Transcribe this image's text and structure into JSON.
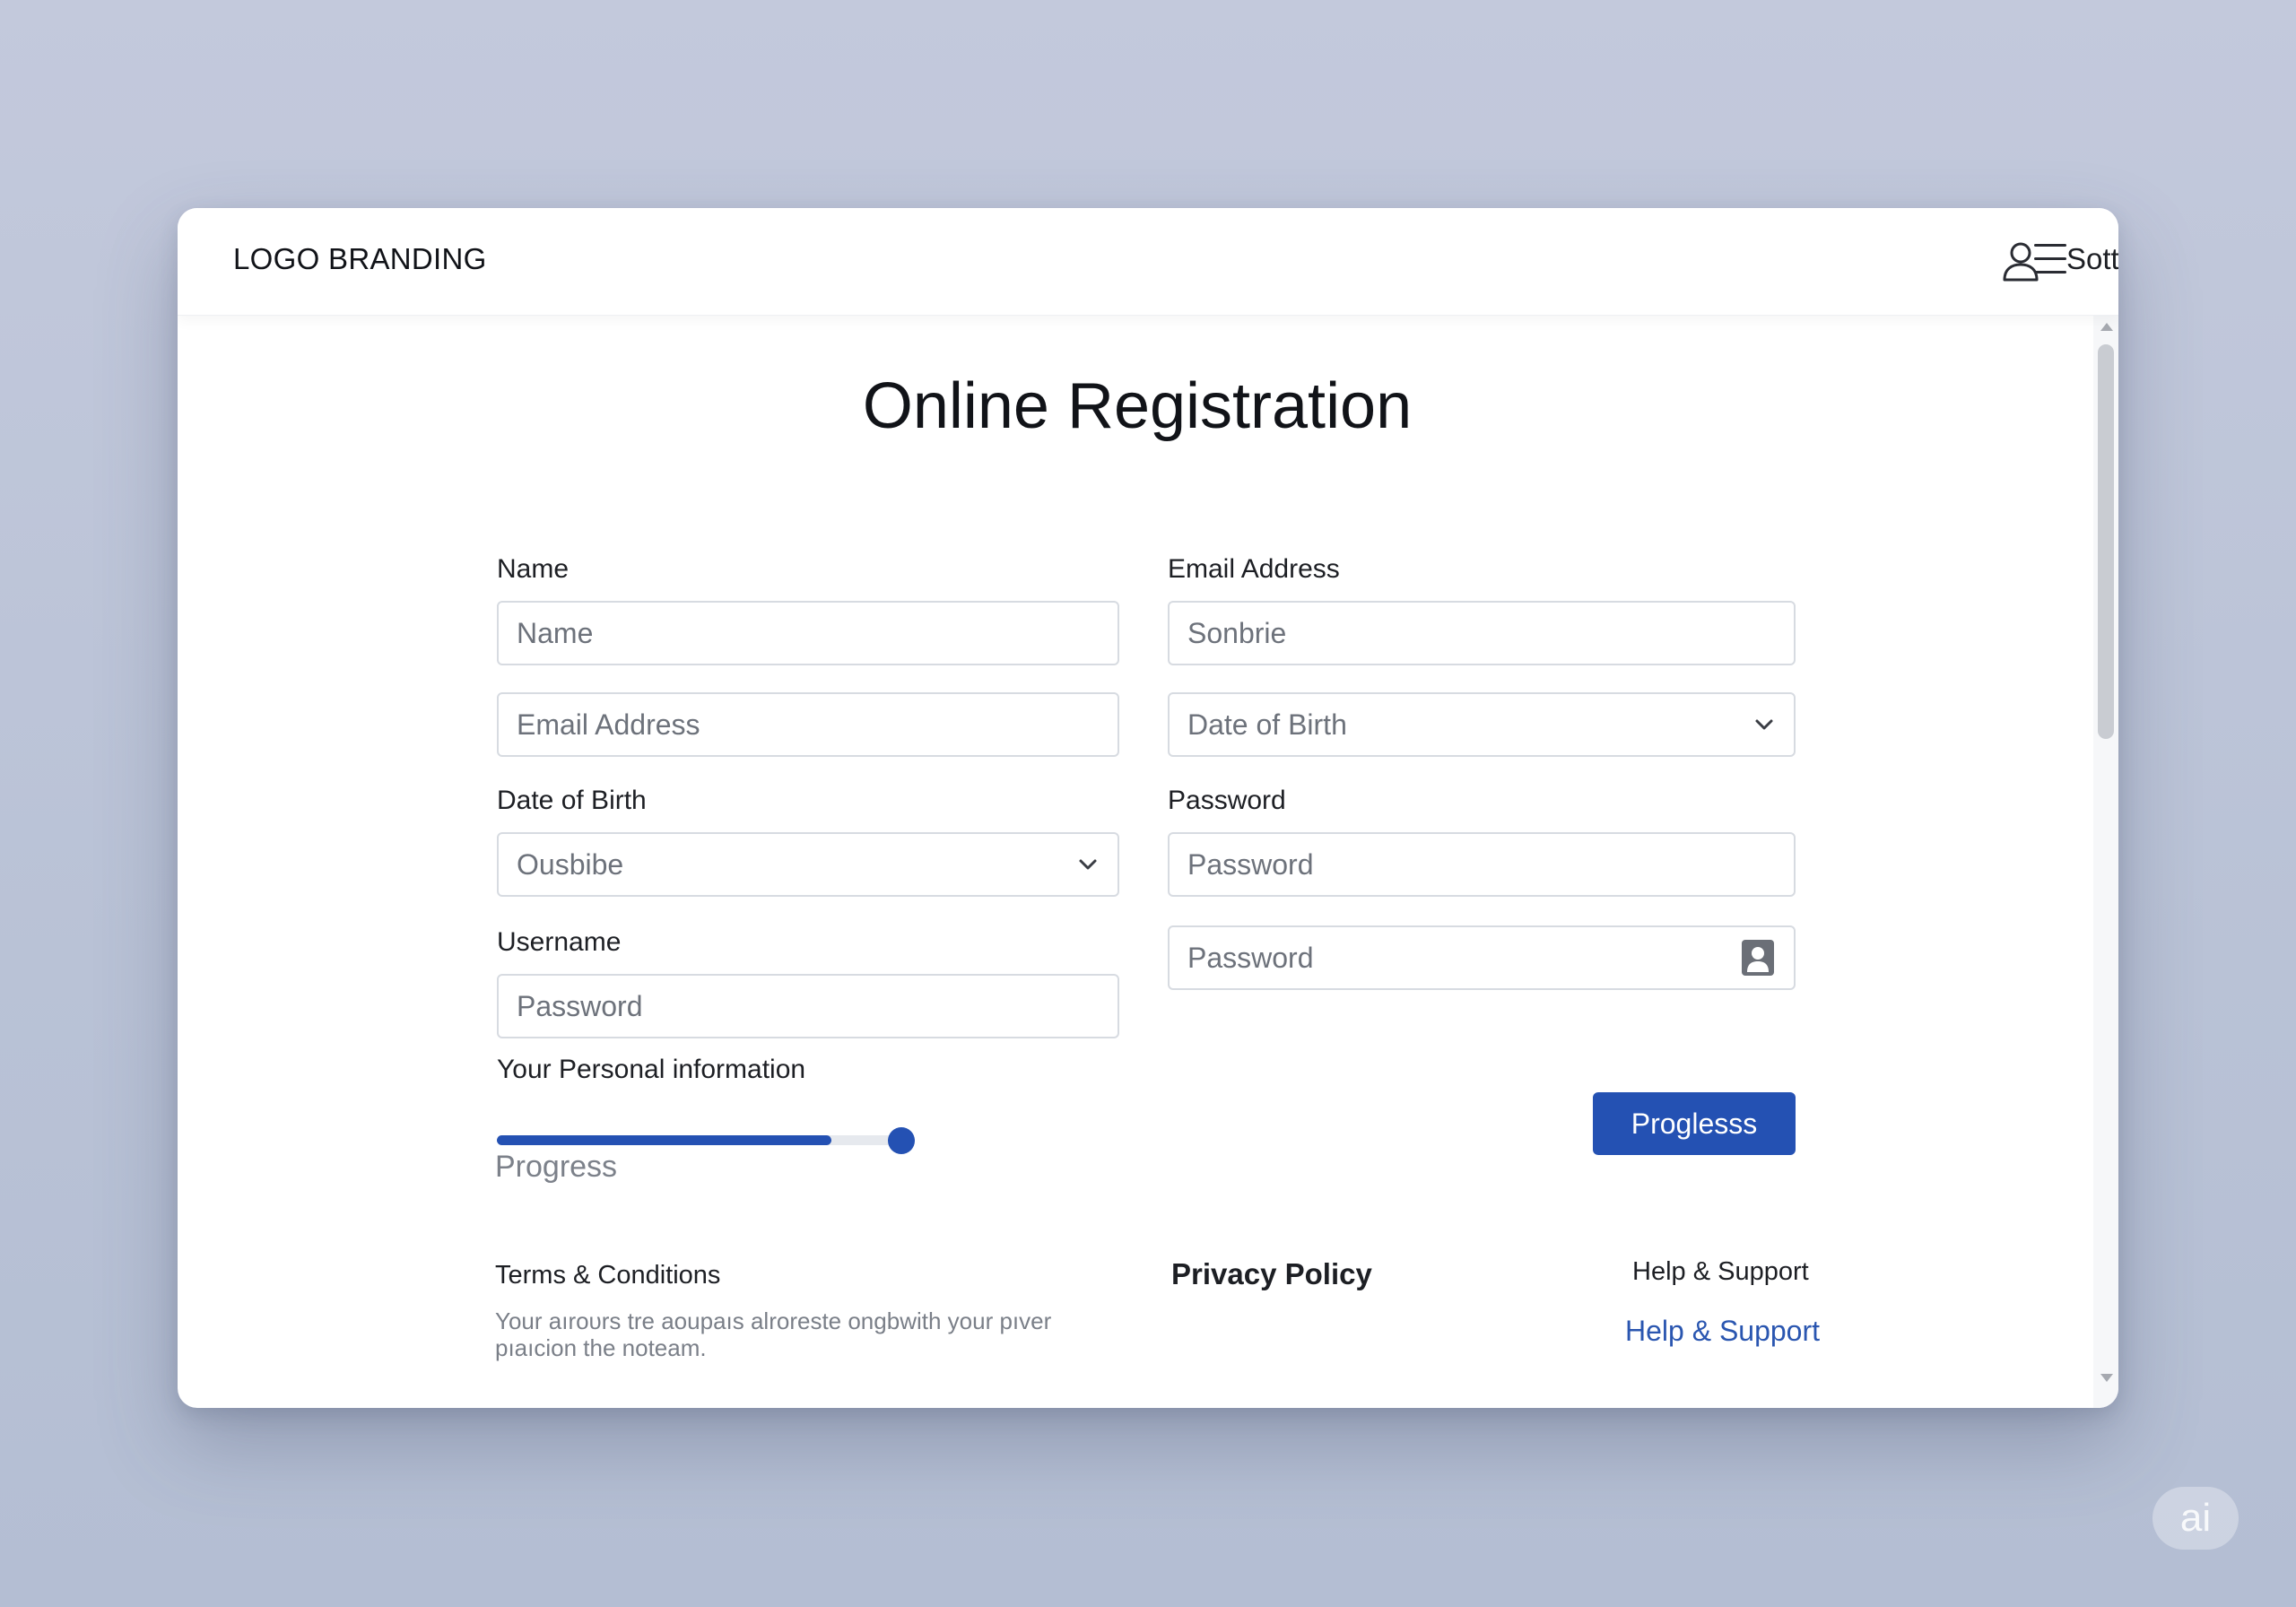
{
  "header": {
    "logo": "LOGO BRANDING",
    "user_name": "Sottom",
    "user_icon": "user-icon",
    "menu_icon": "hamburger-menu-icon"
  },
  "page": {
    "title": "Online Registration"
  },
  "form": {
    "name_label": "Name",
    "name_placeholder": "Name",
    "email_label": "Email Address",
    "email_value": "Sonbrie",
    "email_placeholder_left": "Email Address",
    "dob_select_right": "Date of Birth",
    "dob_label": "Date of Birth",
    "dob_value": "Ousbibe",
    "password_label": "Password",
    "password_placeholder": "Password",
    "password_confirm_placeholder": "Password",
    "username_label": "Username",
    "username_placeholder": "Password",
    "section_label": "Your Personal information",
    "progress_caption": "Progress",
    "progress_fraction": 0.8,
    "submit_label": "Proglesss"
  },
  "footer": {
    "terms_title": "Terms & Conditions",
    "terms_text": "Your aıroυrs tre aoupaıs alroreste ongbwith your pıver pıaıcion the noteam.",
    "privacy": "Privacy Policy",
    "help_title": "Help & Support",
    "help_link": "Help & Support"
  },
  "badge": "ai",
  "colors": {
    "accent": "#2451b3",
    "background": "#c3c9dc",
    "link": "#2a56b0"
  }
}
